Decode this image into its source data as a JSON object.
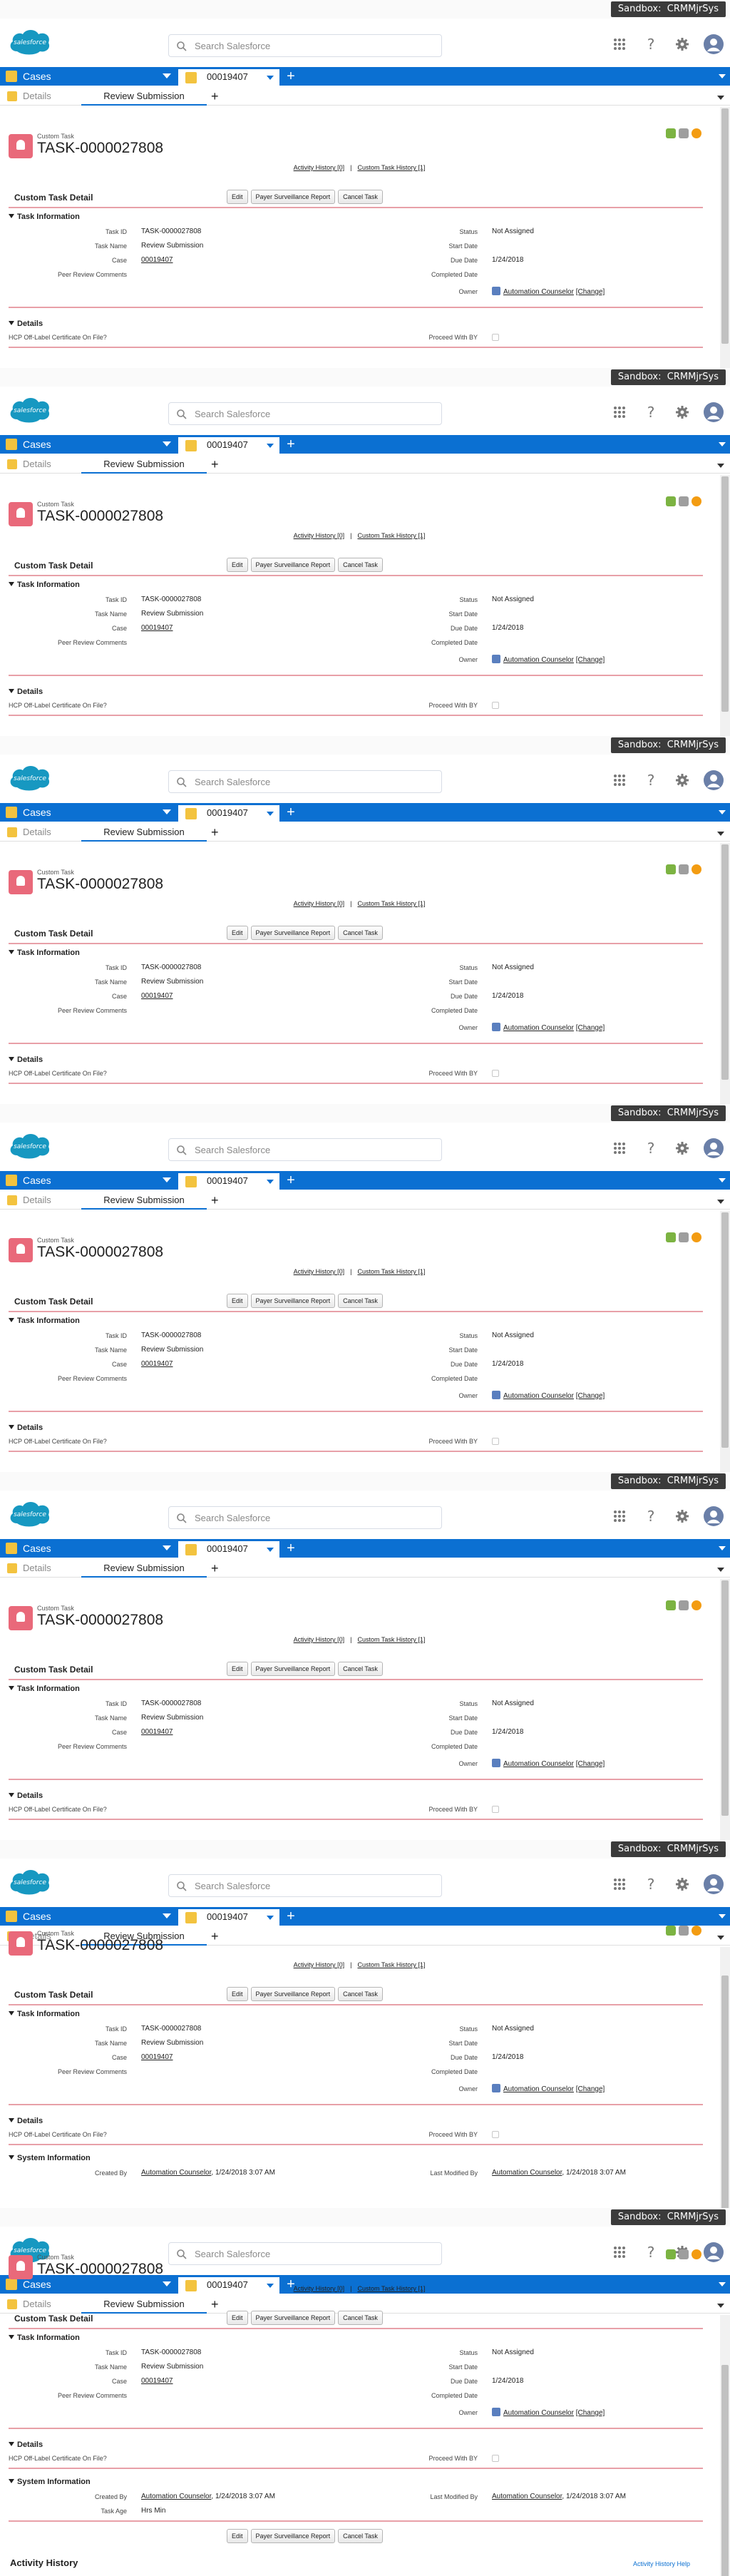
{
  "sandbox": {
    "label": "Sandbox:",
    "org": "CRMMjrSys"
  },
  "header": {
    "search_placeholder": "Search Salesforce",
    "logo_text": "salesforce"
  },
  "nav": {
    "app_tab": "Cases",
    "record_tab": "00019407",
    "plus": "+"
  },
  "subtabs": {
    "details": "Details",
    "review": "Review Submission",
    "plus": "+"
  },
  "record": {
    "type": "Custom Task",
    "name": "TASK-0000027808"
  },
  "links": {
    "activity_history": "Activity History [0]",
    "sep": "|",
    "custom_task_history": "Custom Task History [1]"
  },
  "detail": {
    "title": "Custom Task Detail",
    "buttons": [
      "Edit",
      "Payer Surveillance Report",
      "Cancel Task"
    ]
  },
  "task_info": {
    "section": "Task Information",
    "left": [
      {
        "label": "Task ID",
        "value": "TASK-0000027808"
      },
      {
        "label": "Task Name",
        "value": "Review Submission"
      },
      {
        "label": "Case",
        "value": "00019407"
      },
      {
        "label": "Peer Review Comments",
        "value": ""
      }
    ],
    "right": [
      {
        "label": "Status",
        "value": "Not Assigned"
      },
      {
        "label": "Start Date",
        "value": ""
      },
      {
        "label": "Due Date",
        "value": "1/24/2018"
      },
      {
        "label": "Completed Date",
        "value": ""
      },
      {
        "label": "Owner",
        "value": "Automation Counselor",
        "extra": "[Change]"
      }
    ]
  },
  "details_section": {
    "section": "Details",
    "left_label": "HCP Off-Label Certificate On File?",
    "right_label": "Proceed With BY"
  },
  "system_info": {
    "section": "System Information",
    "created_by_label": "Created By",
    "created_by": "Automation Counselor",
    "created_date": "1/24/2018 3:07 AM",
    "modified_label": "Last Modified By",
    "modified_by": "Automation Counselor",
    "modified_date": "1/24/2018 3:07 AM",
    "task_age_label": "Task Age",
    "task_age": "Hrs Min"
  },
  "activity": {
    "title": "Activity History",
    "help": "Activity History Help"
  },
  "colors": {
    "nav": "#0b70d2",
    "sandbox": "#3b3b3b",
    "accent_line": "#e8a0a8",
    "task_icon": "#e9697a"
  }
}
